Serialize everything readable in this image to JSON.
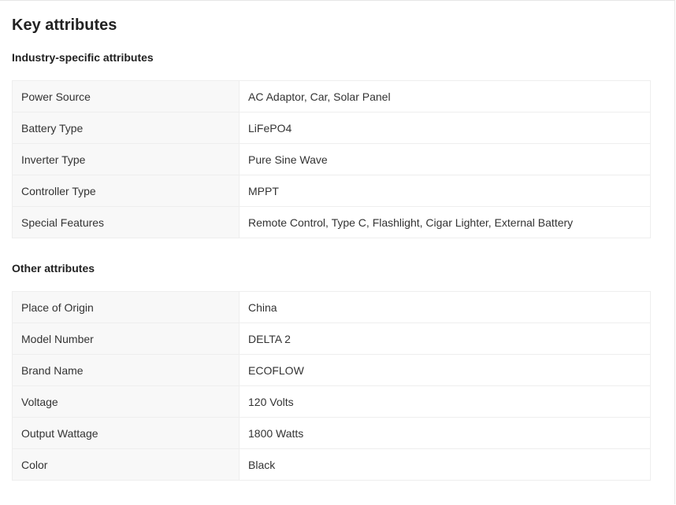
{
  "title": "Key attributes",
  "industry": {
    "heading": "Industry-specific attributes",
    "rows": [
      {
        "name": "Power Source",
        "value": "AC Adaptor, Car, Solar Panel"
      },
      {
        "name": "Battery Type",
        "value": "LiFePO4"
      },
      {
        "name": "Inverter Type",
        "value": "Pure Sine Wave"
      },
      {
        "name": "Controller Type",
        "value": "MPPT"
      },
      {
        "name": "Special Features",
        "value": "Remote Control, Type C, Flashlight, Cigar Lighter, External Battery"
      }
    ]
  },
  "other": {
    "heading": "Other attributes",
    "rows": [
      {
        "name": "Place of Origin",
        "value": "China"
      },
      {
        "name": "Model Number",
        "value": "DELTA 2"
      },
      {
        "name": "Brand Name",
        "value": "ECOFLOW"
      },
      {
        "name": "Voltage",
        "value": "120 Volts"
      },
      {
        "name": "Output Wattage",
        "value": "1800 Watts"
      },
      {
        "name": "Color",
        "value": "Black"
      }
    ]
  }
}
